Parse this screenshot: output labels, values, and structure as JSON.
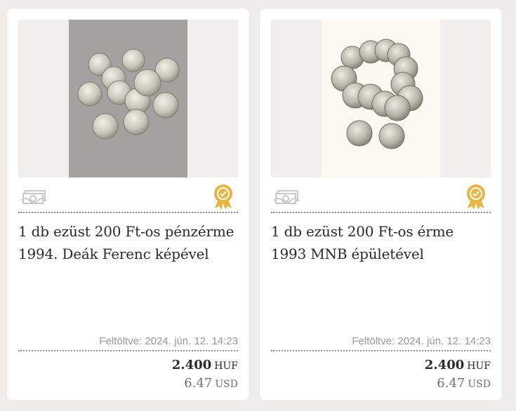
{
  "listings": [
    {
      "image_alt": "Ezüst 200 Ft-os érmék",
      "title": "1 db ezüst 200 Ft-os pénzérme 1994. Deák Ferenc képével",
      "uploaded": "Feltöltve: 2024. jún. 12. 14:23",
      "price_huf": "2.400",
      "currency_huf": "HUF",
      "price_usd": "6.47",
      "currency_usd": "USD",
      "icons": [
        "money-icon",
        "quality-badge-icon"
      ]
    },
    {
      "image_alt": "Ezüst 200 Ft-os érmék MNB épülettel",
      "title": "1 db ezüst 200 Ft-os érme 1993 MNB épületével",
      "uploaded": "Feltöltve: 2024. jún. 12. 14:23",
      "price_huf": "2.400",
      "currency_huf": "HUF",
      "price_usd": "6.47",
      "currency_usd": "USD",
      "icons": [
        "money-icon",
        "quality-badge-icon"
      ]
    }
  ],
  "colors": {
    "background": "#efedeb",
    "card": "#ffffff",
    "badge_gold": "#e7b640",
    "text": "#2a2a2a",
    "muted": "#9a9a9a"
  }
}
